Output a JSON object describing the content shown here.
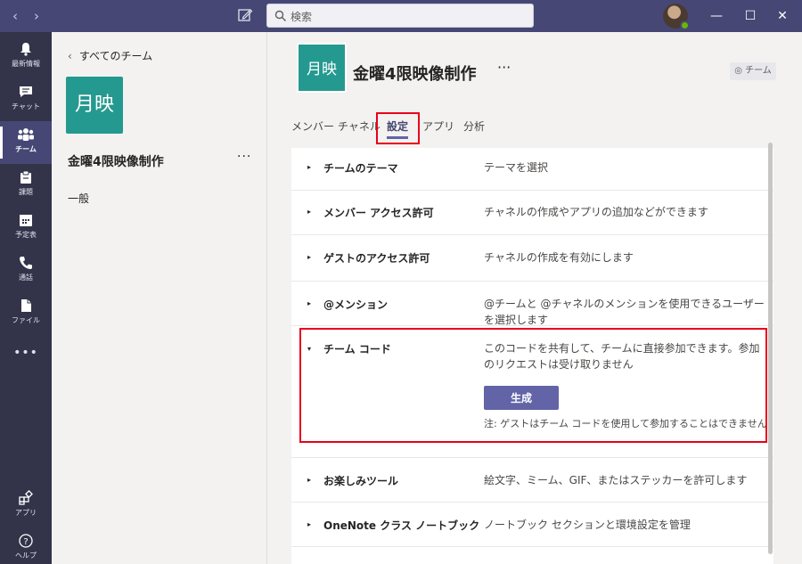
{
  "search": {
    "placeholder": "検索"
  },
  "window": {
    "minimize": "—",
    "maximize": "☐",
    "close": "✕"
  },
  "rail": [
    {
      "key": "activity",
      "label": "最新情報",
      "icon": "bell-icon"
    },
    {
      "key": "chat",
      "label": "チャット",
      "icon": "chat-icon"
    },
    {
      "key": "teams",
      "label": "チーム",
      "icon": "teams-icon",
      "active": true
    },
    {
      "key": "assignments",
      "label": "課題",
      "icon": "assignment-icon"
    },
    {
      "key": "calendar",
      "label": "予定表",
      "icon": "calendar-icon"
    },
    {
      "key": "calls",
      "label": "通話",
      "icon": "phone-icon"
    },
    {
      "key": "files",
      "label": "ファイル",
      "icon": "file-icon"
    },
    {
      "key": "more",
      "label": "•••",
      "icon": "more-icon"
    },
    {
      "key": "apps",
      "label": "アプリ",
      "icon": "apps-icon"
    },
    {
      "key": "help",
      "label": "ヘルプ",
      "icon": "help-icon"
    }
  ],
  "team_panel": {
    "back_label": "すべてのチーム",
    "team_avatar_text": "月映",
    "team_name": "金曜4限映像制作",
    "more": "···",
    "channels": [
      "一般"
    ]
  },
  "header": {
    "team_avatar_text": "月映",
    "team_name": "金曜4限映像制作",
    "more": "···",
    "badge": "チーム"
  },
  "tabs": [
    {
      "label": "メンバー"
    },
    {
      "label": "チャネル"
    },
    {
      "label": "設定",
      "active": true
    },
    {
      "label": "アプリ"
    },
    {
      "label": "分析"
    }
  ],
  "settings": [
    {
      "name": "チームのテーマ",
      "desc": "テーマを選択",
      "expanded": false
    },
    {
      "name": "メンバー アクセス許可",
      "desc": "チャネルの作成やアプリの追加などができます",
      "expanded": false
    },
    {
      "name": "ゲストのアクセス許可",
      "desc": "チャネルの作成を有効にします",
      "expanded": false
    },
    {
      "name": "@メンション",
      "desc": "@チームと @チャネルのメンションを使用できるユーザーを選択します",
      "expanded": false
    },
    {
      "name": "チーム コード",
      "desc": "このコードを共有して、チームに直接参加できます。参加のリクエストは受け取りません",
      "expanded": true,
      "button": "生成",
      "note": "注: ゲストはチーム コードを使用して参加することはできません"
    },
    {
      "name": "お楽しみツール",
      "desc": "絵文字、ミーム、GIF、またはステッカーを許可します",
      "expanded": false
    },
    {
      "name": "OneNote クラス ノートブック",
      "desc": "ノートブック セクションと環境設定を管理",
      "expanded": false
    }
  ]
}
